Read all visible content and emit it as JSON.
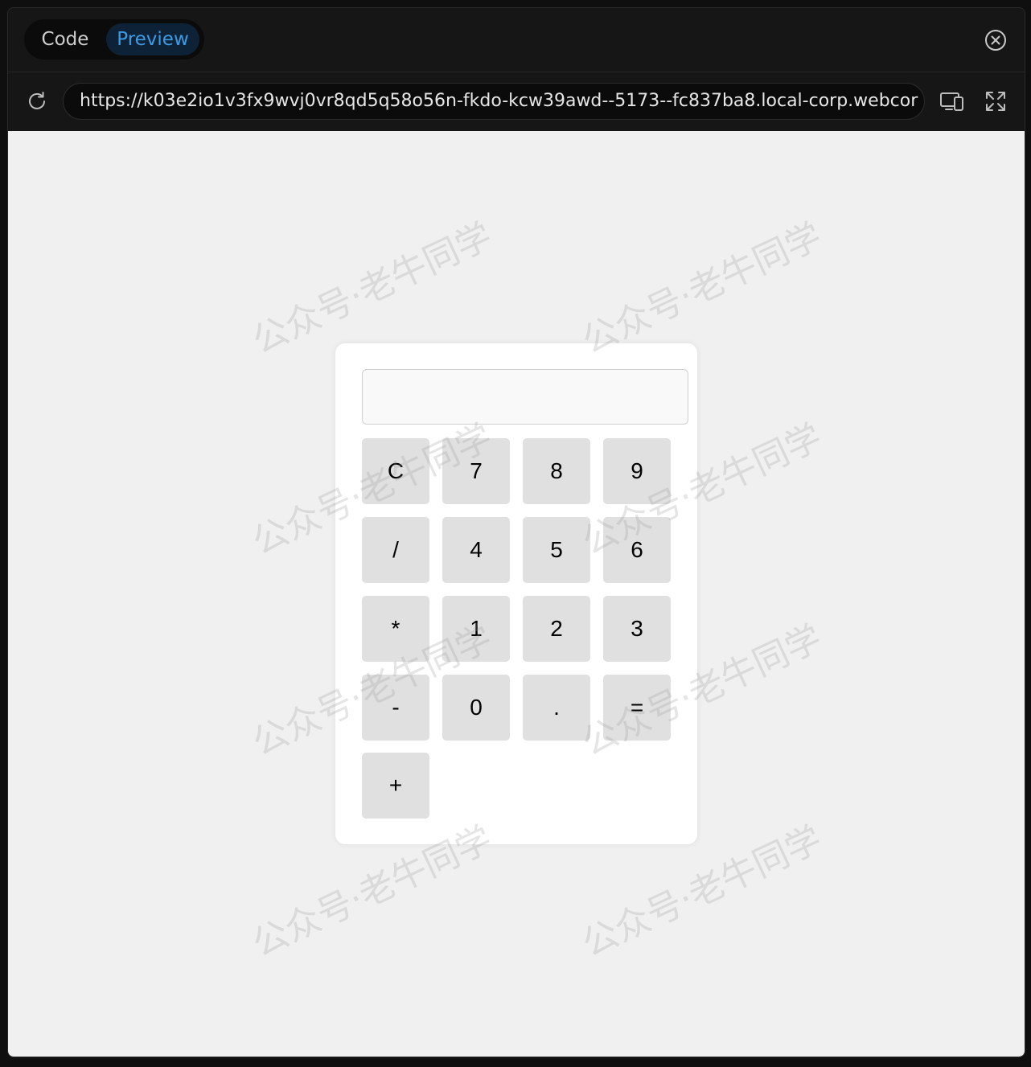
{
  "tabs": {
    "code_label": "Code",
    "preview_label": "Preview",
    "active": "Preview"
  },
  "address_bar": {
    "url": "https://k03e2io1v3fx9wvj0vr8qd5q58o56n-fkdo-kcw39awd--5173--fc837ba8.local-corp.webcor"
  },
  "icons": {
    "close": "close-circle-icon",
    "reload": "reload-icon",
    "devices": "responsive-devices-icon",
    "expand": "fullscreen-expand-icon"
  },
  "calculator": {
    "display_value": "",
    "keys": [
      "C",
      "7",
      "8",
      "9",
      "/",
      "4",
      "5",
      "6",
      "*",
      "1",
      "2",
      "3",
      "-",
      "0",
      ".",
      "=",
      "+"
    ]
  },
  "watermark": {
    "text": "公众号·老牛同学"
  },
  "colors": {
    "accent": "#3c9be6",
    "tab_active_bg": "#0d2236",
    "preview_bg": "#f0f0f0",
    "key_bg": "#e0e0e0"
  }
}
